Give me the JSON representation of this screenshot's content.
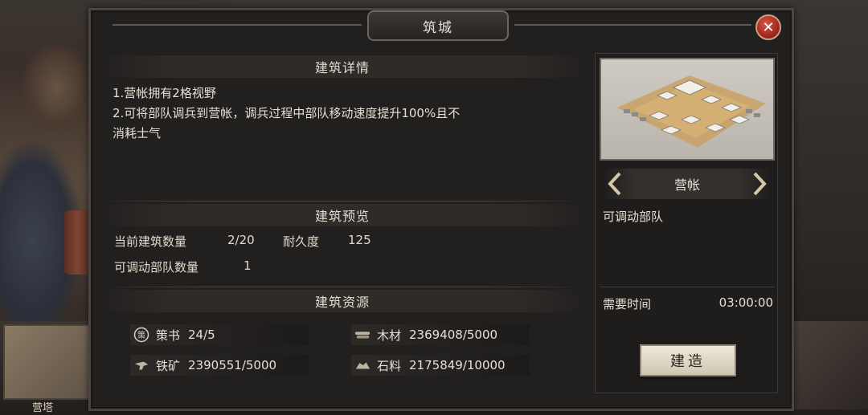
{
  "window": {
    "title": "筑城"
  },
  "details": {
    "header": "建筑详情",
    "lines": [
      "1.营帐拥有2格视野",
      "2.可将部队调兵到营帐，调兵过程中部队移动速度提升100%且不",
      "消耗士气"
    ]
  },
  "preview": {
    "header": "建筑预览",
    "count_label": "当前建筑数量",
    "count_value": "2/20",
    "durability_label": "耐久度",
    "durability_value": "125",
    "troops_label": "可调动部队数量",
    "troops_value": "1"
  },
  "resources": {
    "header": "建筑资源",
    "items": [
      {
        "label": "策书",
        "value": "24/5",
        "icon": "strategy-book-icon"
      },
      {
        "label": "木材",
        "value": "2369408/5000",
        "icon": "wood-icon"
      },
      {
        "label": "铁矿",
        "value": "2390551/5000",
        "icon": "iron-ore-icon"
      },
      {
        "label": "石料",
        "value": "2175849/10000",
        "icon": "stone-icon"
      }
    ]
  },
  "building": {
    "name": "营帐",
    "description": "可调动部队",
    "time_label": "需要时间",
    "time_value": "03:00:00",
    "build_label": "建造"
  },
  "background": {
    "tab_label": "营塔"
  },
  "colors": {
    "close": "#a1281f",
    "accent": "#e6dfd2"
  }
}
